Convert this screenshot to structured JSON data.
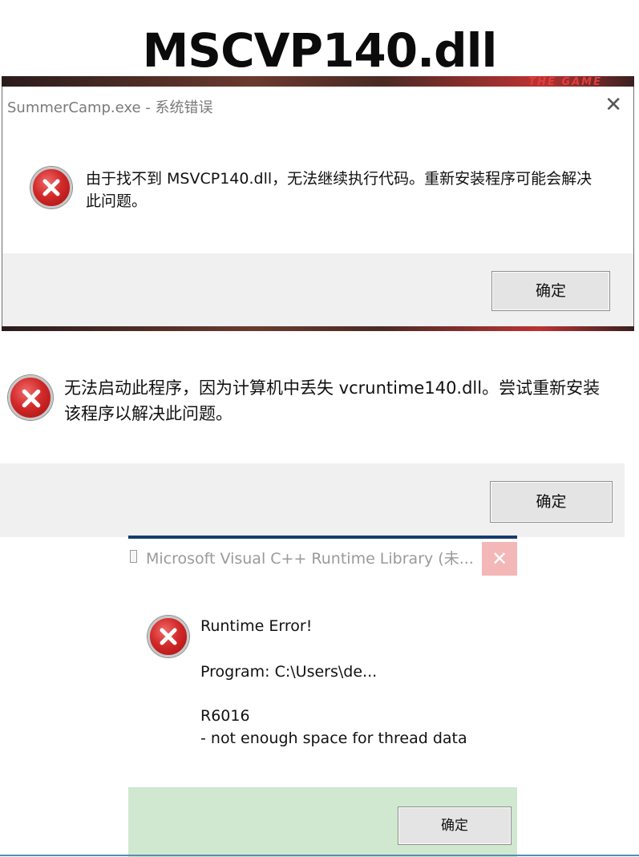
{
  "headline": "MSCVP140.dll",
  "dialog1": {
    "title": "SummerCamp.exe - 系统错误",
    "close_glyph": "✕",
    "message": "由于找不到 MSVCP140.dll，无法继续执行代码。重新安装程序可能会解决此问题。",
    "ok_label": "确定",
    "icon": "error-x-icon"
  },
  "dialog2": {
    "message": "无法启动此程序，因为计算机中丢失 vcruntime140.dll。尝试重新安装该程序以解决此问题。",
    "ok_label": "确定",
    "icon": "error-x-icon"
  },
  "dialog3": {
    "title": "Microsoft Visual C++ Runtime Library (未...",
    "close_glyph": "✕",
    "line1": "Runtime Error!",
    "line2": "Program: C:\\Users\\de...",
    "line3": "R6016",
    "line4": "- not enough space for thread data",
    "ok_label": "确定",
    "icon": "error-x-icon"
  },
  "colors": {
    "error_red": "#d22a2a",
    "footer_gray": "#f0f0f0",
    "footer_green": "#cfe8cf",
    "titlebar_blue": "#163c6e"
  }
}
